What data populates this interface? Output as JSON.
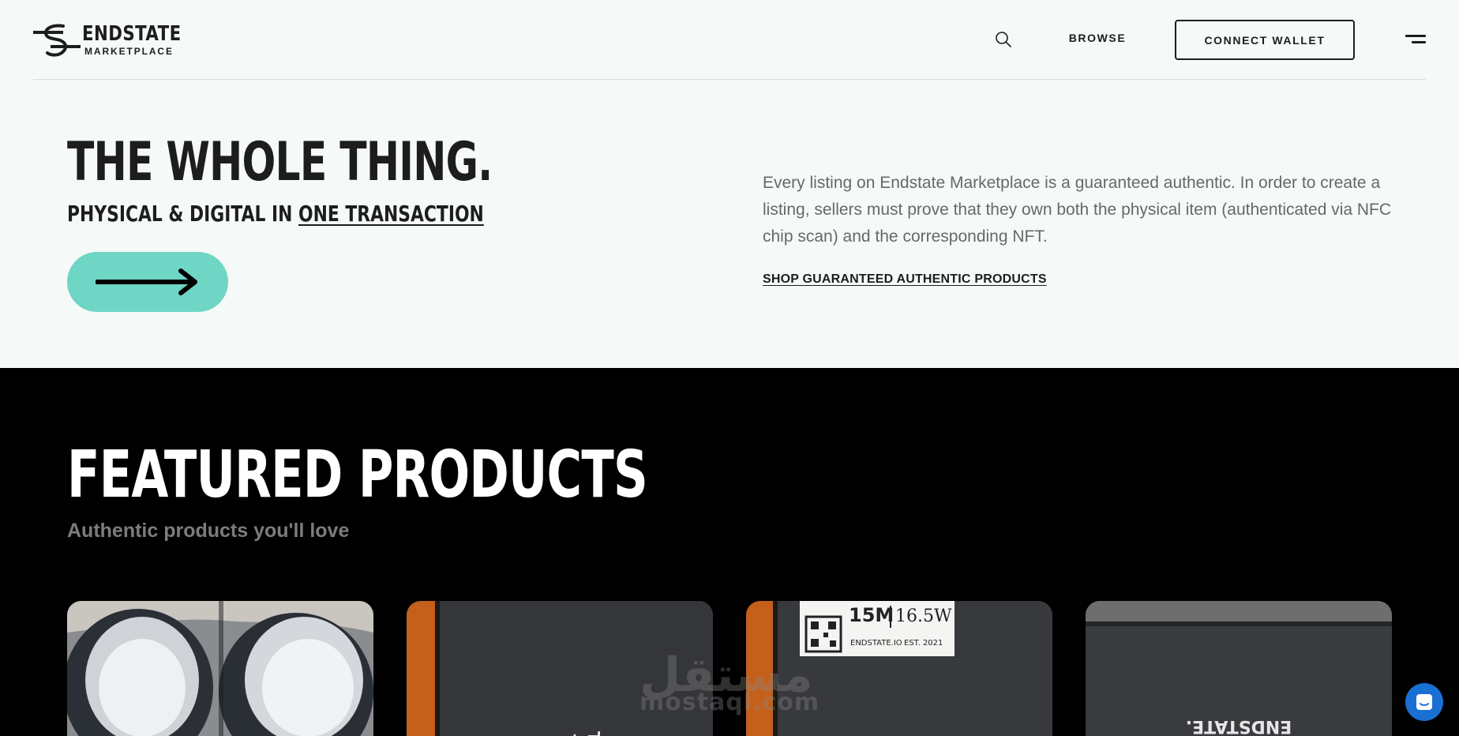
{
  "header": {
    "logo_word": "ENDSTATE",
    "logo_sub": "MARKETPLACE",
    "search_icon": "search-icon",
    "browse_label": "BROWSE",
    "connect_wallet_label": "CONNECT WALLET",
    "menu_icon": "menu-icon"
  },
  "hero": {
    "title": "THE WHOLE THING.",
    "subtitle_prefix": "PHYSICAL & DIGITAL IN ",
    "subtitle_underlined": "ONE TRANSACTION",
    "arrow_icon": "arrow-right-icon",
    "description": "Every listing on Endstate Marketplace is a guaranteed authentic. In order to create a listing, sellers must prove that they own both the physical item (authenticated via NFC chip scan) and the corresponding NFT.",
    "link_label": "SHOP GUARANTEED AUTHENTIC PRODUCTS",
    "accent_color": "#6fd5c5"
  },
  "featured": {
    "title": "FEATURED PRODUCTS",
    "subtitle": "Authentic products you'll love",
    "products": [
      {
        "image": "sneakers-photo"
      },
      {
        "image": "shoebox-endstate-photo"
      },
      {
        "image": "shoebox-label-photo",
        "label_size": "15M",
        "label_size_w": "16.5W",
        "label_site": "ENDSTATE.IO",
        "label_est": "EST. 2021"
      },
      {
        "image": "shoebox-lid-photo",
        "lid_text": "ENDSTATE."
      }
    ]
  },
  "watermark": {
    "arabic": "مستقل",
    "latin": "mostaql.com"
  },
  "chat": {
    "icon": "chat-icon",
    "color": "#1a6fd3"
  }
}
